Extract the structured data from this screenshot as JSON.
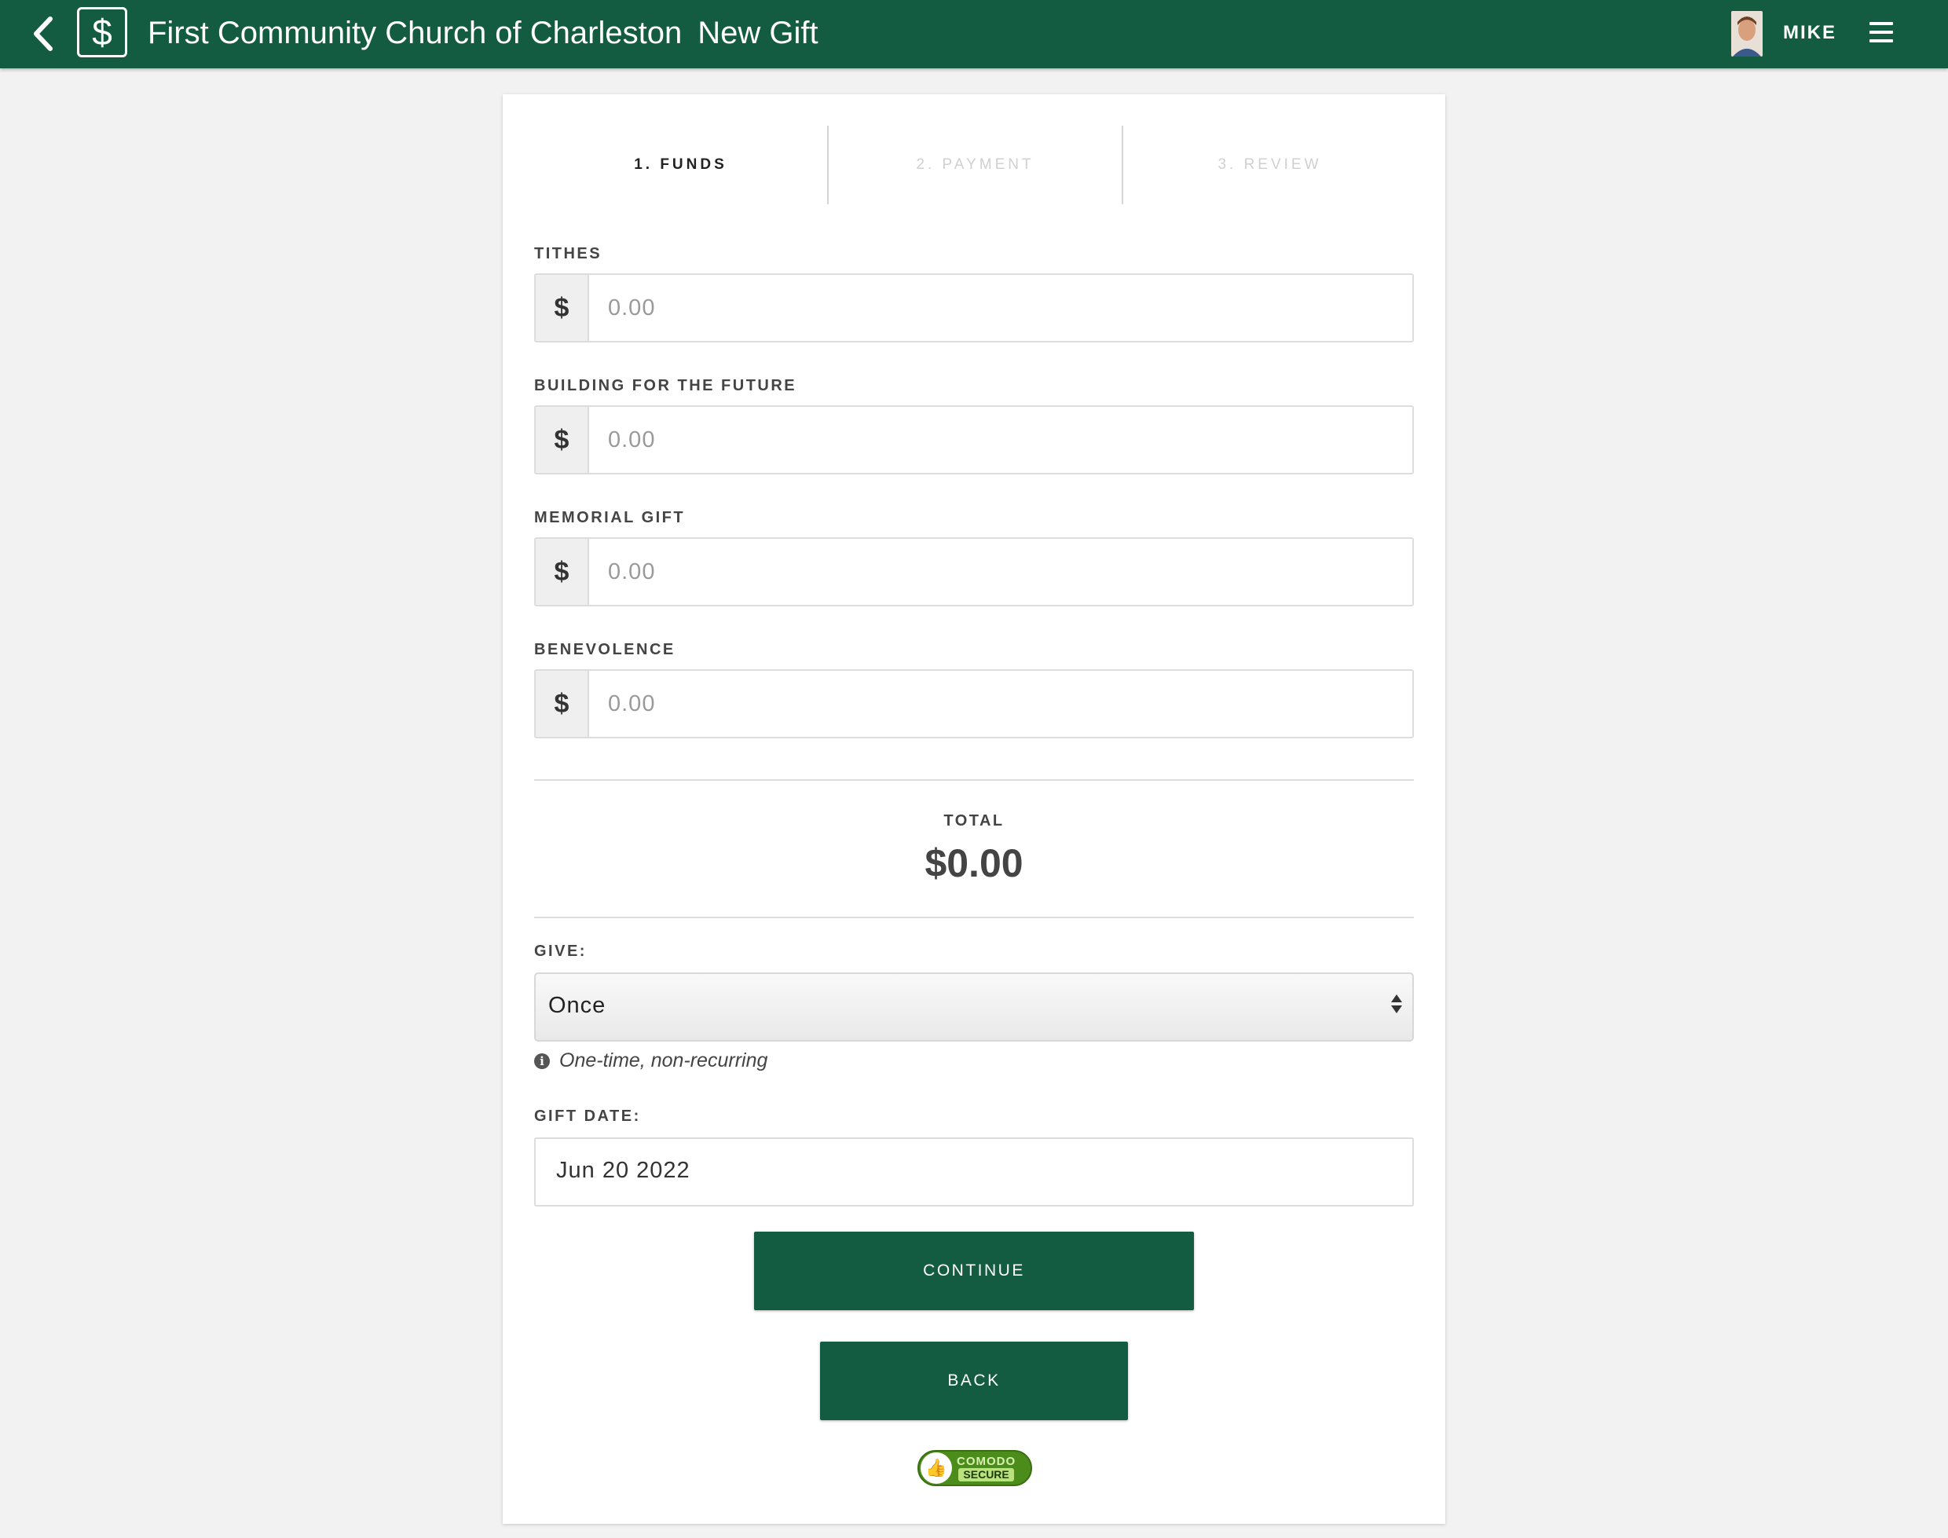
{
  "header": {
    "back_icon": "chevron-left-icon",
    "app_icon": "dollar-icon",
    "app_icon_glyph": "$",
    "org_name": "First Community Church of Charleston",
    "page_title": "New Gift",
    "user_name": "MIKE",
    "menu_icon": "hamburger-menu-icon",
    "brand_color": "#135c42"
  },
  "steps": [
    {
      "label": "1. FUNDS",
      "state": "active"
    },
    {
      "label": "2. PAYMENT",
      "state": "inactive"
    },
    {
      "label": "3. REVIEW",
      "state": "inactive"
    }
  ],
  "funds": [
    {
      "label": "TITHES",
      "currency_symbol": "$",
      "placeholder": "0.00"
    },
    {
      "label": "BUILDING FOR THE FUTURE",
      "currency_symbol": "$",
      "placeholder": "0.00"
    },
    {
      "label": "MEMORIAL GIFT",
      "currency_symbol": "$",
      "placeholder": "0.00"
    },
    {
      "label": "BENEVOLENCE",
      "currency_symbol": "$",
      "placeholder": "0.00"
    }
  ],
  "total": {
    "label": "TOTAL",
    "value": "$0.00"
  },
  "give": {
    "label": "GIVE:",
    "selected": "Once",
    "hint": "One-time, non-recurring",
    "hint_icon": "info-icon"
  },
  "gift_date": {
    "label": "GIFT DATE:",
    "value": "Jun 20 2022"
  },
  "actions": {
    "continue_label": "CONTINUE",
    "back_label": "BACK"
  },
  "security_badge": {
    "line1": "COMODO",
    "line2": "SECURE",
    "icon": "thumbs-up-icon"
  }
}
